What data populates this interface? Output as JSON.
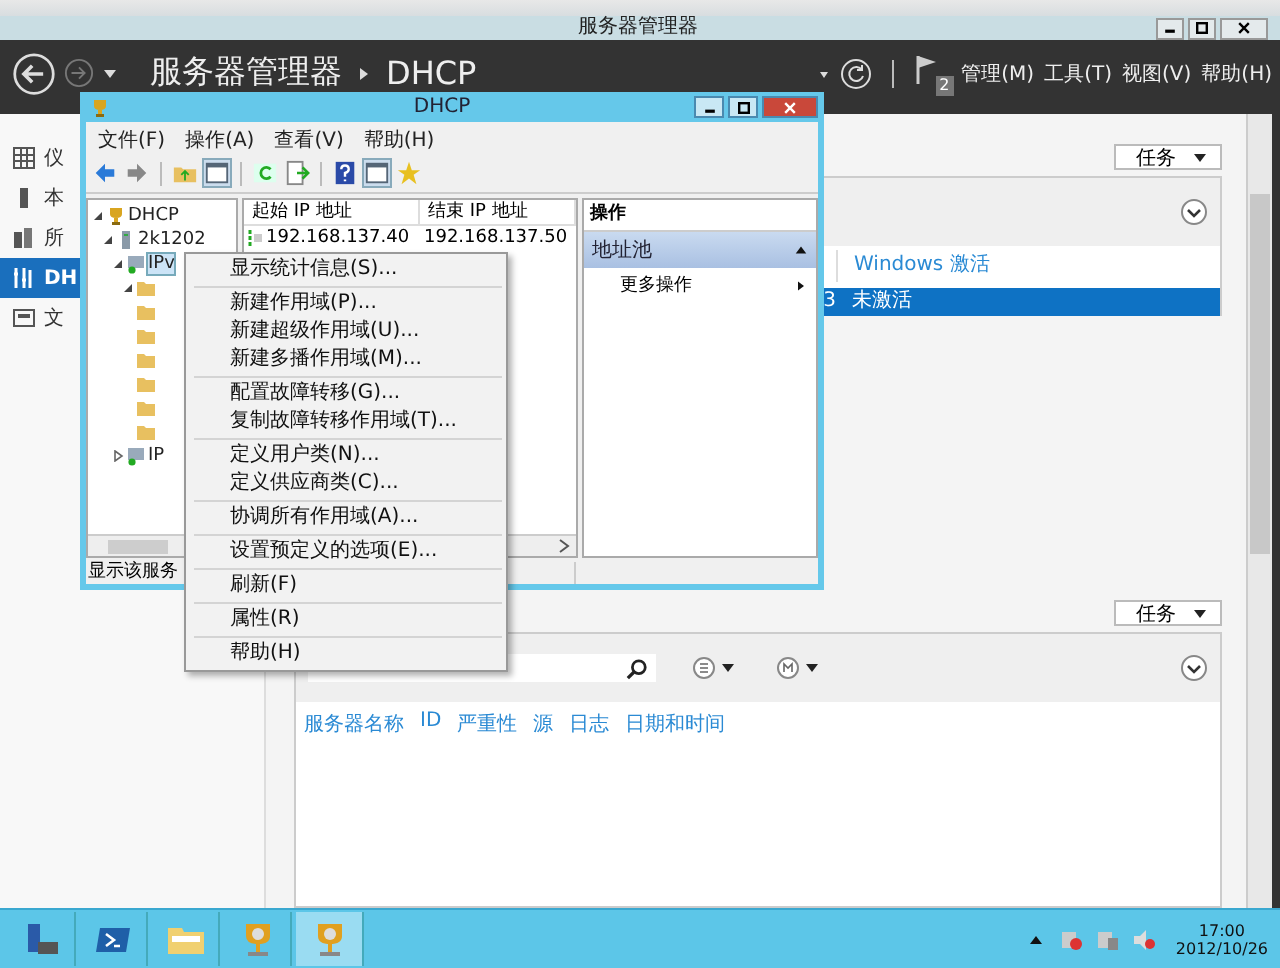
{
  "server_manager": {
    "title": "服务器管理器",
    "breadcrumb_root": "服务器管理器",
    "breadcrumb_page": "DHCP",
    "notification_count": "2",
    "menus": [
      "管理(M)",
      "工具(T)",
      "视图(V)",
      "帮助(H)"
    ],
    "nav_items": [
      {
        "label": "仪",
        "kind": "grid",
        "selected": false
      },
      {
        "label": "本",
        "kind": "server",
        "selected": false
      },
      {
        "label": "所",
        "kind": "servers",
        "selected": false
      },
      {
        "label": "DH",
        "kind": "dhcp",
        "selected": true
      },
      {
        "label": "文",
        "kind": "files",
        "selected": false
      }
    ],
    "upper_panel": {
      "tasks_button": "任务",
      "columns": [
        "",
        "Windows 激活"
      ],
      "rows": [
        {
          "cells": [
            "3",
            "未激活"
          ],
          "selected": true
        }
      ]
    },
    "lower_panel": {
      "tasks_button": "任务",
      "columns": [
        "服务器名称",
        "ID",
        "严重性",
        "源",
        "日志",
        "日期和时间"
      ]
    }
  },
  "dhcp_window": {
    "title": "DHCP",
    "menus": [
      "文件(F)",
      "操作(A)",
      "查看(V)",
      "帮助(H)"
    ],
    "tree": [
      {
        "label": "DHCP",
        "kind": "root",
        "expanded": true,
        "children": [
          {
            "label": "2k1202",
            "kind": "server",
            "expanded": true,
            "children": [
              {
                "label": "IPv",
                "kind": "protocol",
                "expanded": true,
                "selected": true,
                "children": [
                  {
                    "kind": "folder",
                    "expanded": true
                  },
                  {
                    "kind": "folder"
                  },
                  {
                    "kind": "folder"
                  },
                  {
                    "kind": "folder"
                  },
                  {
                    "kind": "folder"
                  },
                  {
                    "kind": "folder"
                  },
                  {
                    "kind": "folder"
                  }
                ]
              },
              {
                "label": "IP",
                "kind": "protocol",
                "expanded": false,
                "selected": false
              }
            ]
          }
        ]
      }
    ],
    "columns": [
      "起始 IP 地址",
      "结束 IP 地址"
    ],
    "rows": [
      [
        "192.168.137.40",
        "192.168.137.50"
      ]
    ],
    "actions": {
      "header": "操作",
      "section": "地址池",
      "items": [
        "更多操作"
      ]
    },
    "status": "显示该服务"
  },
  "context_menu": {
    "groups": [
      [
        "显示统计信息(S)..."
      ],
      [
        "新建作用域(P)...",
        "新建超级作用域(U)...",
        "新建多播作用域(M)..."
      ],
      [
        "配置故障转移(G)...",
        "复制故障转移作用域(T)..."
      ],
      [
        "定义用户类(N)...",
        "定义供应商类(C)..."
      ],
      [
        "协调所有作用域(A)..."
      ],
      [
        "设置预定义的选项(E)..."
      ],
      [
        "刷新(F)"
      ],
      [
        "属性(R)"
      ],
      [
        "帮助(H)"
      ]
    ]
  },
  "taskbar": {
    "apps": [
      {
        "kind": "server-manager",
        "selected": false
      },
      {
        "kind": "powershell",
        "selected": false
      },
      {
        "kind": "explorer",
        "selected": false
      },
      {
        "kind": "dhcp",
        "selected": false
      },
      {
        "kind": "dhcp",
        "selected": true
      }
    ],
    "time": "17:00",
    "date": "2012/10/26"
  }
}
